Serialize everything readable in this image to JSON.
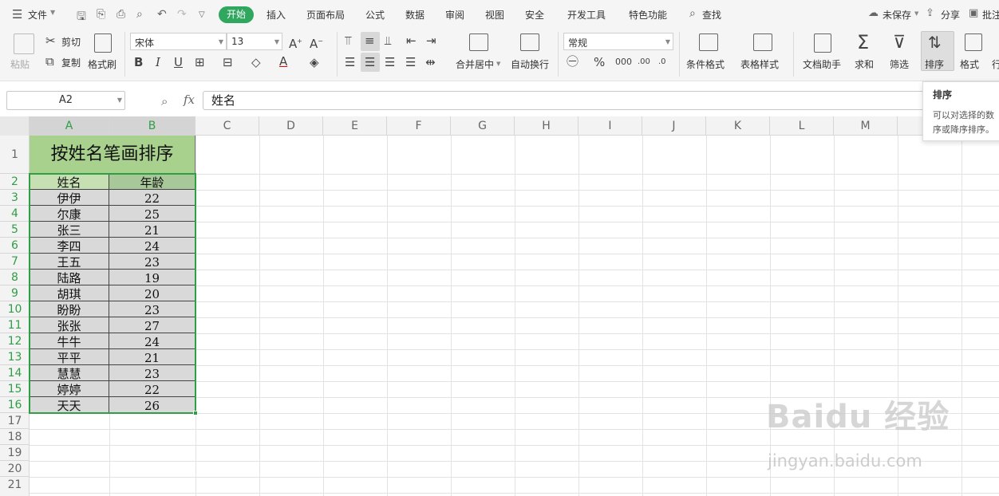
{
  "menubar": {
    "file": "文件",
    "tabs": [
      "开始",
      "插入",
      "页面布局",
      "公式",
      "数据",
      "审阅",
      "视图",
      "安全",
      "开发工具",
      "特色功能"
    ],
    "search": "查找",
    "unsaved": "未保存",
    "share": "分享",
    "comment": "批注"
  },
  "ribbon": {
    "paste": "粘贴",
    "cut": "剪切",
    "copy": "复制",
    "format_painter": "格式刷",
    "font_name": "宋体",
    "font_size": "13",
    "merge_center": "合并居中",
    "wrap_text": "自动换行",
    "number_format": "常规",
    "percent": "%",
    "conditional_format": "条件格式",
    "table_style": "表格样式",
    "doc_helper": "文档助手",
    "sum": "求和",
    "filter": "筛选",
    "sort": "排序",
    "format": "格式",
    "row_col": "行"
  },
  "formula_bar": {
    "cell_ref": "A2",
    "fx": "fx",
    "content": "姓名"
  },
  "columns": [
    "A",
    "B",
    "C",
    "D",
    "E",
    "F",
    "G",
    "H",
    "I",
    "J",
    "K",
    "L",
    "M"
  ],
  "rows": [
    "1",
    "2",
    "3",
    "4",
    "5",
    "6",
    "7",
    "8",
    "9",
    "10",
    "11",
    "12",
    "13",
    "14",
    "15",
    "16",
    "17",
    "18",
    "19",
    "20",
    "21"
  ],
  "sheet": {
    "title": "按姓名笔画排序",
    "header": [
      "姓名",
      "年龄"
    ],
    "data": [
      [
        "伊伊",
        "22"
      ],
      [
        "尔康",
        "25"
      ],
      [
        "张三",
        "21"
      ],
      [
        "李四",
        "24"
      ],
      [
        "王五",
        "23"
      ],
      [
        "陆路",
        "19"
      ],
      [
        "胡琪",
        "20"
      ],
      [
        "盼盼",
        "23"
      ],
      [
        "张张",
        "27"
      ],
      [
        "牛牛",
        "24"
      ],
      [
        "平平",
        "21"
      ],
      [
        "慧慧",
        "23"
      ],
      [
        "婷婷",
        "22"
      ],
      [
        "天天",
        "26"
      ]
    ]
  },
  "tooltip": {
    "title": "排序",
    "line1": "可以对选择的数",
    "line2": "序或降序排序。"
  },
  "watermark": {
    "logo": "Baidu 经验",
    "url": "jingyan.baidu.com"
  },
  "colors": {
    "accent_green": "#2fa75e",
    "title_fill": "#a9d18e",
    "header_fill": "#c6e0b4",
    "selection_fill": "#d9d9d9",
    "selection_border": "#2f9e44"
  }
}
